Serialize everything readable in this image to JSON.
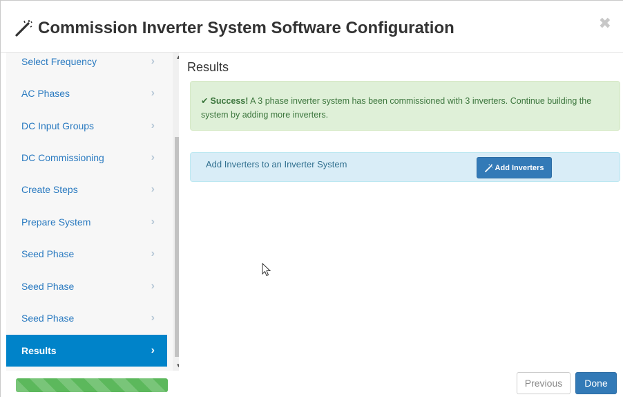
{
  "modal": {
    "title": "Commission Inverter System Software Configuration",
    "title_icon": "magic-wand-icon",
    "close_glyph": "✖"
  },
  "sidebar": {
    "items": [
      {
        "label": "Select Frequency",
        "active": false
      },
      {
        "label": "AC Phases",
        "active": false
      },
      {
        "label": "DC Input Groups",
        "active": false
      },
      {
        "label": "DC Commissioning",
        "active": false
      },
      {
        "label": "Create Steps",
        "active": false
      },
      {
        "label": "Prepare System",
        "active": false
      },
      {
        "label": "Seed Phase",
        "active": false
      },
      {
        "label": "Seed Phase",
        "active": false
      },
      {
        "label": "Seed Phase",
        "active": false
      },
      {
        "label": "Results",
        "active": true
      }
    ],
    "chevron": "›",
    "active_color": "#0083c9"
  },
  "progress": {
    "fraction": 1.0,
    "color": "#5cb85c"
  },
  "main": {
    "title": "Results",
    "success_alert": {
      "check_glyph": "✔",
      "strong": "Success!",
      "message": " A 3 phase inverter system has been commissioned with 3 inverters. Continue building the system by adding more inverters."
    },
    "info_panel": {
      "text": "Add Inverters to an Inverter System",
      "button_label": "Add Inverters"
    }
  },
  "footer": {
    "previous_label": "Previous",
    "done_label": "Done"
  },
  "colors": {
    "primary": "#337ab7",
    "success_bg": "#dff0d8",
    "info_bg": "#d9edf7",
    "link": "#2a7ac0"
  }
}
